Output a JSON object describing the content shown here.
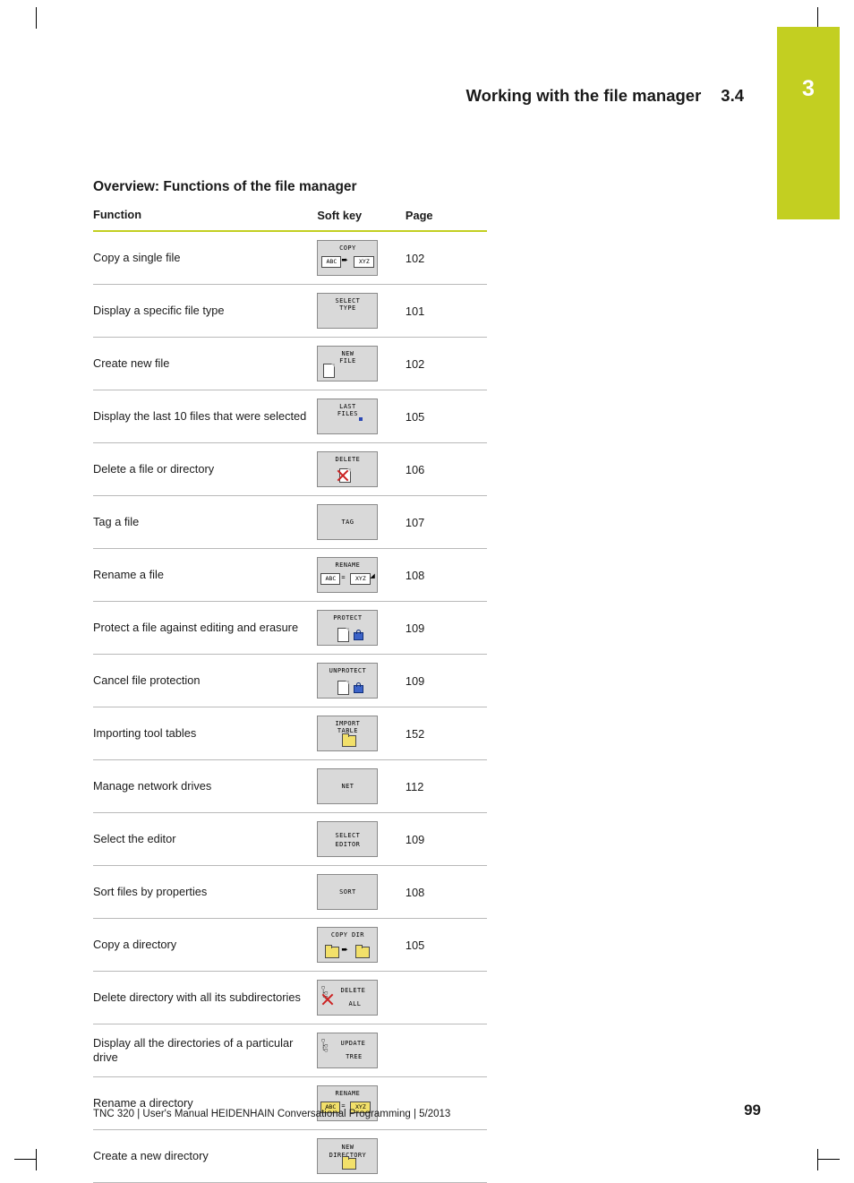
{
  "chapter": {
    "number": "3"
  },
  "runhead": {
    "title": "Working with the file manager",
    "section": "3.4"
  },
  "page_title": "Overview: Functions of the file manager",
  "table": {
    "headers": {
      "function": "Function",
      "softkey": "Soft key",
      "page": "Page"
    },
    "rows": [
      {
        "function": "Copy a single file",
        "softkey_label": "COPY",
        "softkey_sub": "",
        "softkey_name": "copy-file-softkey",
        "page": "102"
      },
      {
        "function": "Display a specific file type",
        "softkey_label": "SELECT",
        "softkey_sub": "TYPE",
        "softkey_name": "select-type-softkey",
        "page": "101"
      },
      {
        "function": "Create new file",
        "softkey_label": "NEW",
        "softkey_sub": "FILE",
        "softkey_name": "new-file-softkey",
        "page": "102"
      },
      {
        "function": "Display the last 10 files that were selected",
        "softkey_label": "LAST",
        "softkey_sub": "FILES",
        "softkey_name": "last-files-softkey",
        "page": "105"
      },
      {
        "function": "Delete a file or directory",
        "softkey_label": "DELETE",
        "softkey_sub": "",
        "softkey_name": "delete-softkey",
        "page": "106"
      },
      {
        "function": "Tag a file",
        "softkey_label": "TAG",
        "softkey_sub": "",
        "softkey_name": "tag-softkey",
        "page": "107"
      },
      {
        "function": "Rename a file",
        "softkey_label": "RENAME",
        "softkey_sub": "",
        "softkey_name": "rename-file-softkey",
        "page": "108"
      },
      {
        "function": "Protect a file against editing and erasure",
        "softkey_label": "PROTECT",
        "softkey_sub": "",
        "softkey_name": "protect-softkey",
        "page": "109"
      },
      {
        "function": "Cancel file protection",
        "softkey_label": "UNPROTECT",
        "softkey_sub": "",
        "softkey_name": "unprotect-softkey",
        "page": "109"
      },
      {
        "function": "Importing tool tables",
        "softkey_label": "IMPORT",
        "softkey_sub": "TABLE",
        "softkey_name": "import-table-softkey",
        "page": "152"
      },
      {
        "function": "Manage network drives",
        "softkey_label": "NET",
        "softkey_sub": "",
        "softkey_name": "net-softkey",
        "page": "112"
      },
      {
        "function": "Select the editor",
        "softkey_label": "SELECT",
        "softkey_sub": "EDITOR",
        "softkey_name": "select-editor-softkey",
        "page": "109"
      },
      {
        "function": "Sort files by properties",
        "softkey_label": "SORT",
        "softkey_sub": "",
        "softkey_name": "sort-softkey",
        "page": "108"
      },
      {
        "function": "Copy a directory",
        "softkey_label": "COPY DIR",
        "softkey_sub": "",
        "softkey_name": "copy-dir-softkey",
        "page": "105"
      },
      {
        "function": "Delete directory with all its subdirectories",
        "softkey_label": "DELETE",
        "softkey_sub": "ALL",
        "softkey_name": "delete-all-softkey",
        "page": ""
      },
      {
        "function": "Display all the directories of a particular drive",
        "softkey_label": "UPDATE",
        "softkey_sub": "TREE",
        "softkey_name": "update-tree-softkey",
        "page": ""
      },
      {
        "function": "Rename a directory",
        "softkey_label": "RENAME",
        "softkey_sub": "",
        "softkey_name": "rename-dir-softkey",
        "page": ""
      },
      {
        "function": "Create a new directory",
        "softkey_label": "NEW",
        "softkey_sub": "DIRECTORY",
        "softkey_name": "new-directory-softkey",
        "page": ""
      }
    ],
    "softkey_glyph_text": {
      "abc": "ABC",
      "xyz": "XYZ",
      "equals": "=",
      "arrow": "➨"
    }
  },
  "footer": {
    "text": "TNC 320 | User's Manual HEIDENHAIN Conversational Programming | 5/2013",
    "page_number": "99"
  },
  "colors": {
    "accent": "#c3cf21",
    "rule": "#b9b9b9",
    "softkey_bg": "#d9d9d9"
  }
}
